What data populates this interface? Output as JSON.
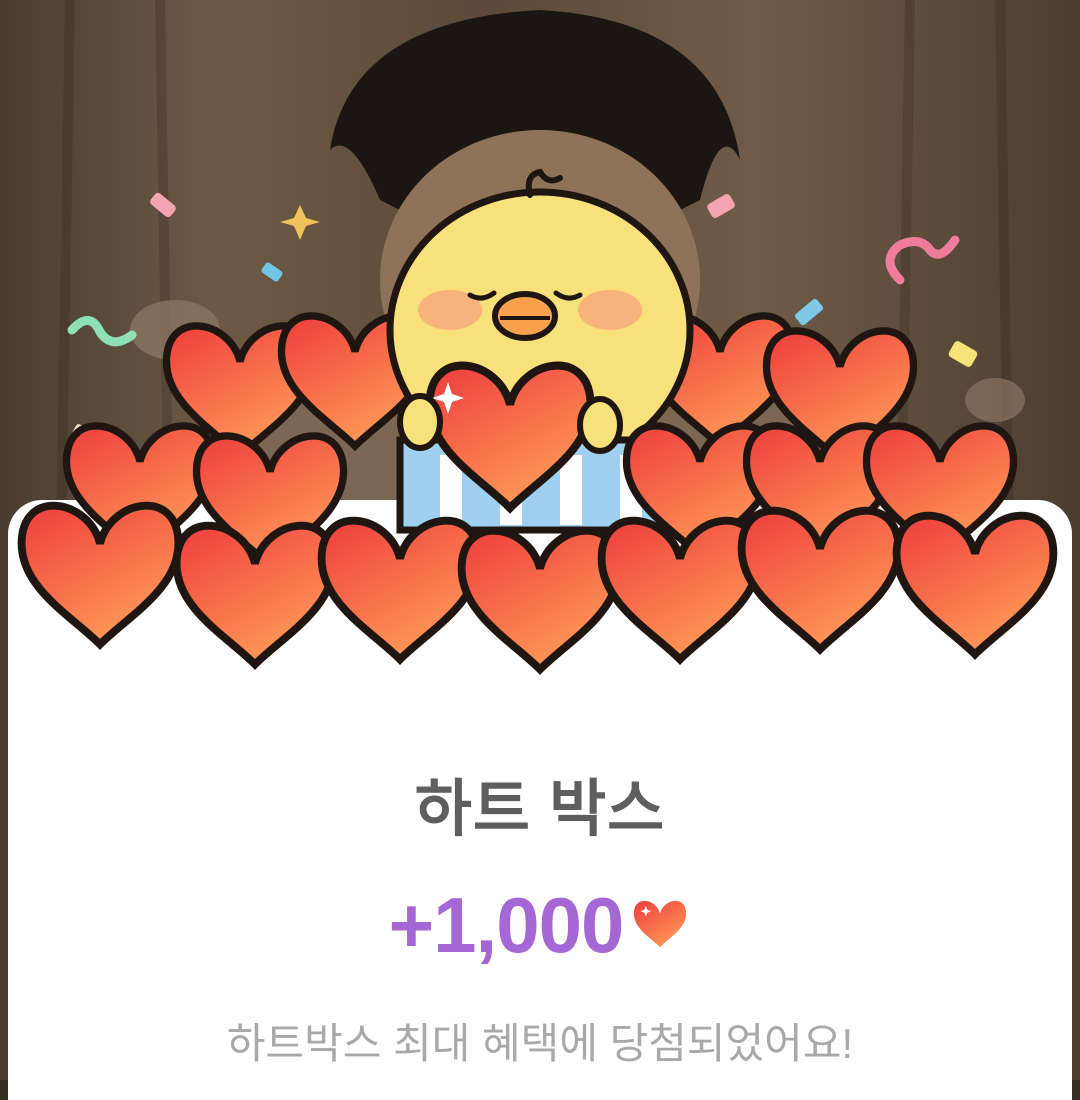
{
  "popup": {
    "title": "하트 박스",
    "reward_amount": "+1,000",
    "reward_icon": "heart-icon",
    "message": "하트박스 최대 혜택에 당첨되었어요!"
  },
  "colors": {
    "accent": "#a467d4",
    "title": "#5e5e5e",
    "message": "#a9a9a9",
    "heart": "#f4513f"
  }
}
